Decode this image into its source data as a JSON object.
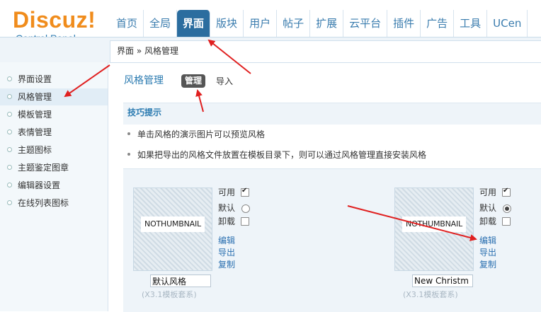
{
  "header": {
    "logo_main": "Discuz!",
    "logo_sub": "Control Panel",
    "nav": [
      "首页",
      "全局",
      "界面",
      "版块",
      "用户",
      "帖子",
      "扩展",
      "云平台",
      "插件",
      "广告",
      "工具",
      "UCen"
    ],
    "active_nav": "界面"
  },
  "breadcrumb": "界面 » 风格管理",
  "sidebar": {
    "items": [
      "界面设置",
      "风格管理",
      "模板管理",
      "表情管理",
      "主题图标",
      "主题鉴定图章",
      "编辑器设置",
      "在线列表图标"
    ],
    "active": "风格管理"
  },
  "main": {
    "title": "风格管理",
    "tabs": [
      {
        "label": "管理",
        "active": true
      },
      {
        "label": "导入",
        "active": false
      }
    ],
    "tips_title": "技巧提示",
    "tips": [
      "单击风格的演示图片可以预览风格",
      "如果把导出的风格文件放置在模板目录下，则可以通过风格管理直接安装风格"
    ]
  },
  "styles": [
    {
      "thumbnail": "NOTHUMBNAIL",
      "opt_enabled": "可用",
      "opt_default": "默认",
      "opt_uninstall": "卸载",
      "enabled": true,
      "is_default": false,
      "uninstall": false,
      "edit": "编辑",
      "export": "导出",
      "copy": "复制",
      "name": "默认风格",
      "package": "(X3.1模板套系)"
    },
    {
      "thumbnail": "NOTHUMBNAIL",
      "opt_enabled": "可用",
      "opt_default": "默认",
      "opt_uninstall": "卸载",
      "enabled": true,
      "is_default": true,
      "uninstall": false,
      "edit": "编辑",
      "export": "导出",
      "copy": "复制",
      "name": "New Christm",
      "package": "(X3.1模板套系)"
    }
  ],
  "colors": {
    "accent": "#2b6d9f",
    "annotation": "#e02020",
    "logo": "#f08c1c"
  }
}
